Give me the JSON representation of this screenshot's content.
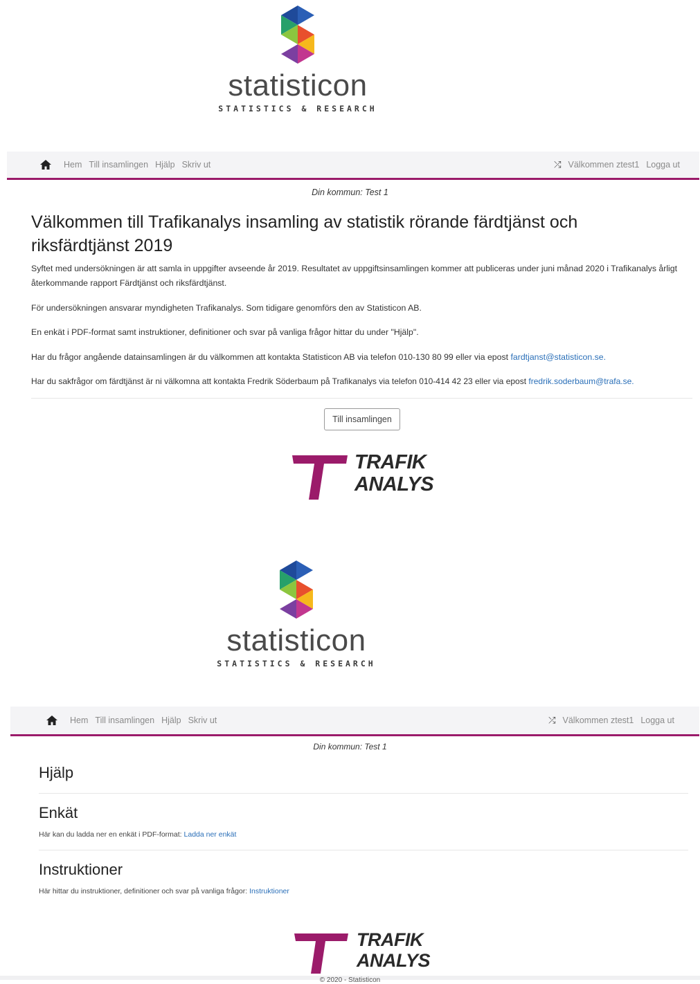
{
  "screen1": {
    "logo": {
      "word": "statisticon",
      "tagline": "STATISTICS & RESEARCH"
    },
    "nav": {
      "items": [
        "Hem",
        "Till insamlingen",
        "Hjälp",
        "Skriv ut"
      ],
      "welcome": "Välkommen ztest1",
      "logout": "Logga ut"
    },
    "municipality": "Din kommun: Test 1",
    "title": "Välkommen till Trafikanalys insamling av statistik rörande färdtjänst och riksfärdtjänst 2019",
    "paragraphs": {
      "p1": "Syftet med undersökningen är att samla in uppgifter avseende år 2019. Resultatet av uppgiftsinsamlingen kommer att publiceras under juni månad 2020 i Trafikanalys årligt återkommande rapport Färdtjänst och riksfärdtjänst.",
      "p2": "För undersökningen ansvarar myndigheten Trafikanalys. Som tidigare genomförs den av Statisticon AB.",
      "p3": "En enkät i PDF-format samt instruktioner, definitioner och svar på vanliga frågor hittar du under \"Hjälp\".",
      "p4_text": "Har du frågor angående datainsamlingen är du välkommen att kontakta Statisticon AB via telefon 010-130 80 99 eller via epost",
      "p4_link": "fardtjanst@statisticon.se.",
      "p5_text": "Har du sakfrågor om färdtjänst är ni välkomna att kontakta Fredrik Söderbaum på Trafikanalys via telefon 010-414 42 23 eller via epost",
      "p5_link": "fredrik.soderbaum@trafa.se."
    },
    "button_label": "Till insamlingen",
    "trafik": {
      "line1": "TRAFIK",
      "line2": "ANALYS"
    }
  },
  "screen2": {
    "logo": {
      "word": "statisticon",
      "tagline": "STATISTICS & RESEARCH"
    },
    "nav": {
      "items": [
        "Hem",
        "Till insamlingen",
        "Hjälp",
        "Skriv ut"
      ],
      "welcome": "Välkommen ztest1",
      "logout": "Logga ut"
    },
    "municipality": "Din kommun: Test 1",
    "heading_help": "Hjälp",
    "heading_survey": "Enkät",
    "survey_text": "Här kan du ladda ner en enkät i PDF-format:",
    "survey_link": "Ladda ner enkät",
    "heading_instructions": "Instruktioner",
    "instructions_text": "Här hittar du instruktioner, definitioner och svar på vanliga frågor:",
    "instructions_link": "Instruktioner",
    "trafik": {
      "line1": "TRAFIK",
      "line2": "ANALYS"
    },
    "footer": "© 2020 - Statisticon"
  },
  "colors": {
    "accent": "#9b1b6a",
    "link": "#2a6fb8",
    "nav_bg": "#f4f4f6"
  },
  "icons": {
    "home": "home-icon",
    "shuffle": "shuffle-icon"
  }
}
